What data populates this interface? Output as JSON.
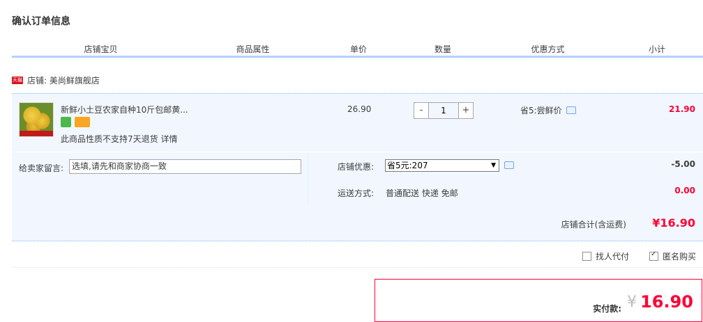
{
  "page_title": "确认订单信息",
  "table_headers": [
    "店铺宝贝",
    "商品属性",
    "单价",
    "数量",
    "优惠方式",
    "小计"
  ],
  "shop": {
    "badge": "天猫",
    "label": "店铺: 美尚鲜旗舰店"
  },
  "item": {
    "title": "新鲜小土豆农家自种10斤包邮黄...",
    "no_return": "此商品性质不支持7天退货 详情",
    "price": "26.90",
    "quantity": "1",
    "qty_minus": "-",
    "qty_plus": "+",
    "promo": "省5:尝鲜价",
    "subtotal": "21.90"
  },
  "message": {
    "label": "给卖家留言:",
    "value": "选填,请先和商家协商一致"
  },
  "shop_discount": {
    "label": "店铺优惠:",
    "selected": "省5元:207",
    "amount": "-5.00"
  },
  "shipping": {
    "label": "运送方式:",
    "value": "普通配送 快递 免邮",
    "amount": "0.00"
  },
  "shop_total": {
    "label": "店铺合计(含运费)",
    "value": "¥16.90"
  },
  "options": {
    "proxy_pay": "找人代付",
    "anonymous": "匿名购买"
  },
  "payment": {
    "label": "实付款:",
    "currency": "¥",
    "value": "16.90"
  },
  "colors": {
    "accent_red": "#ff0036",
    "header_border": "#b2d1ff",
    "row_bg": "#f2f7ff"
  }
}
